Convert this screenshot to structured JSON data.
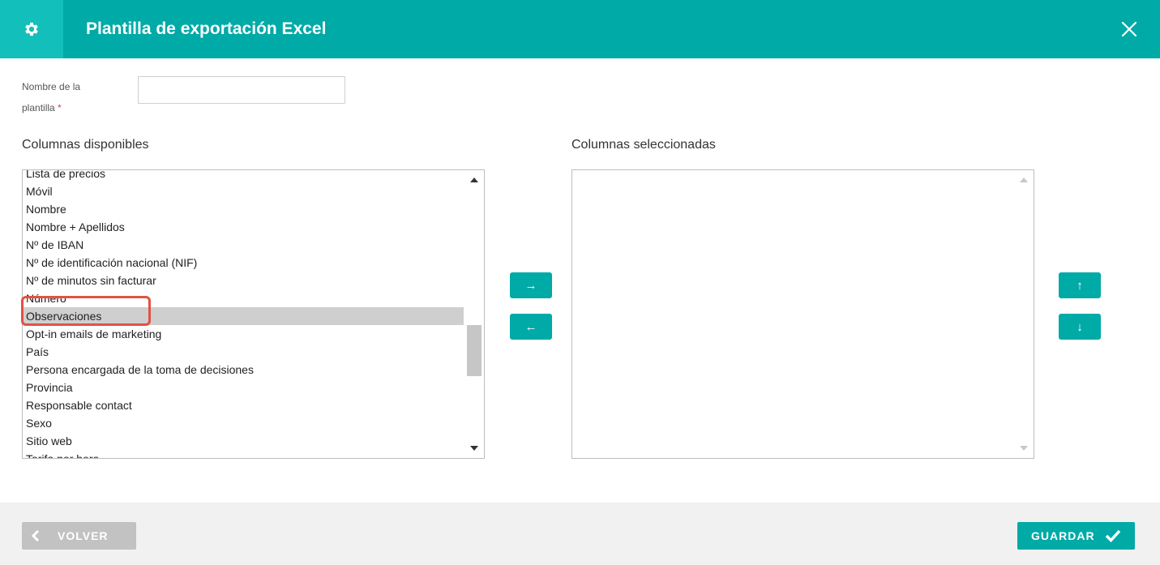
{
  "header": {
    "title": "Plantilla de exportación Excel",
    "icon": "gear-icon",
    "close_icon": "close-icon",
    "background": "#00aaa7"
  },
  "form": {
    "name_label_line1": "Nombre de la",
    "name_label_line2": "plantilla",
    "required_mark": "*",
    "name_value": ""
  },
  "available": {
    "title": "Columnas disponibles",
    "items": [
      "Lista de precios",
      "Móvil",
      "Nombre",
      "Nombre + Apellidos",
      "Nº de IBAN",
      "Nº de identificación nacional (NIF)",
      "Nº de minutos sin facturar",
      "Número",
      "Observaciones",
      "Opt-in emails de marketing",
      "País",
      "Persona encargada de la toma de decisiones",
      "Provincia",
      "Responsable contact",
      "Sexo",
      "Sitio web",
      "Tarifa por hora"
    ],
    "selected_item": "Observaciones"
  },
  "selected": {
    "title": "Columnas seleccionadas",
    "items": []
  },
  "controls": {
    "add": "→",
    "remove": "←",
    "move_up": "↑",
    "move_down": "↓"
  },
  "footer": {
    "back_label": "VOLVER",
    "save_label": "GUARDAR"
  }
}
